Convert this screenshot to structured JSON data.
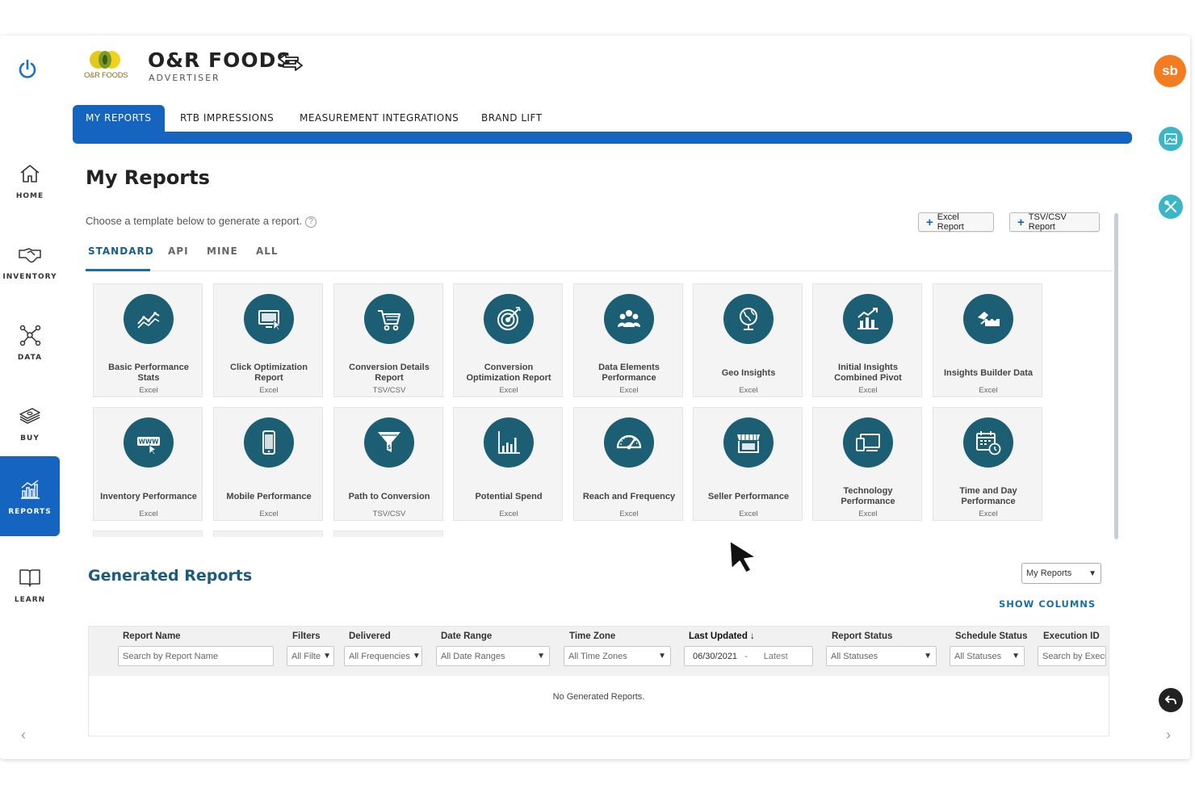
{
  "nav": {
    "items": [
      {
        "label": "HOME",
        "icon": "home-icon"
      },
      {
        "label": "INVENTORY",
        "icon": "handshake-icon"
      },
      {
        "label": "DATA",
        "icon": "network-icon"
      },
      {
        "label": "BUY",
        "icon": "money-icon"
      },
      {
        "label": "REPORTS",
        "icon": "bar-chart-icon"
      },
      {
        "label": "LEARN",
        "icon": "book-icon"
      }
    ],
    "active": "REPORTS",
    "accent": "#1565c0"
  },
  "header": {
    "logo_text": "O&R FOODS",
    "brand_name": "O&R FOODS",
    "brand_sub": "ADVERTISER"
  },
  "top_tabs": [
    "MY REPORTS",
    "RTB IMPRESSIONS",
    "MEASUREMENT INTEGRATIONS",
    "BRAND LIFT"
  ],
  "page": {
    "title": "My Reports",
    "subtext": "Choose a template below to generate a report.",
    "add_excel": "Excel Report",
    "add_tsv": "TSV/CSV Report"
  },
  "sub_tabs": [
    "STANDARD",
    "API",
    "MINE",
    "ALL"
  ],
  "templates": [
    {
      "name": "Basic Performance Stats",
      "type": "Excel",
      "icon": "trend-line-icon"
    },
    {
      "name": "Click Optimization Report",
      "type": "Excel",
      "icon": "monitor-click-icon"
    },
    {
      "name": "Conversion Details Report",
      "type": "TSV/CSV",
      "icon": "shopping-cart-icon"
    },
    {
      "name": "Conversion Optimization Report",
      "type": "Excel",
      "icon": "target-icon"
    },
    {
      "name": "Data Elements Performance",
      "type": "Excel",
      "icon": "people-group-icon"
    },
    {
      "name": "Geo Insights",
      "type": "Excel",
      "icon": "globe-icon"
    },
    {
      "name": "Initial Insights Combined Pivot",
      "type": "Excel",
      "icon": "growth-chart-icon"
    },
    {
      "name": "Insights Builder Data",
      "type": "Excel",
      "icon": "puzzle-icon"
    },
    {
      "name": "Inventory Performance",
      "type": "Excel",
      "icon": "www-click-icon"
    },
    {
      "name": "Mobile Performance",
      "type": "Excel",
      "icon": "mobile-phone-icon"
    },
    {
      "name": "Path to Conversion",
      "type": "TSV/CSV",
      "icon": "funnel-icon"
    },
    {
      "name": "Potential Spend",
      "type": "Excel",
      "icon": "bar-graph-icon"
    },
    {
      "name": "Reach and Frequency",
      "type": "Excel",
      "icon": "speedometer-icon"
    },
    {
      "name": "Seller Performance",
      "type": "Excel",
      "icon": "storefront-icon"
    },
    {
      "name": "Technology Performance",
      "type": "Excel",
      "icon": "devices-icon"
    },
    {
      "name": "Time and Day Performance",
      "type": "Excel",
      "icon": "calendar-clock-icon"
    }
  ],
  "generated": {
    "title": "Generated Reports",
    "scope_select": "My Reports",
    "show_columns": "SHOW COLUMNS",
    "columns": [
      {
        "header": "Report Name",
        "filter": "Search by Report Name"
      },
      {
        "header": "Filters",
        "filter": "All Filters"
      },
      {
        "header": "Delivered",
        "filter": "All Frequencies"
      },
      {
        "header": "Date Range",
        "filter": "All Date Ranges"
      },
      {
        "header": "Time Zone",
        "filter": "All Time Zones"
      },
      {
        "header": "Last Updated ↓",
        "filter_from": "06/30/2021",
        "filter_sep": "-",
        "filter_to": "Latest"
      },
      {
        "header": "Report Status",
        "filter": "All Statuses"
      },
      {
        "header": "Schedule Status",
        "filter": "All Statuses"
      },
      {
        "header": "Execution ID",
        "filter": "Search by Execution ID"
      }
    ],
    "empty_message": "No Generated Reports."
  },
  "rail": {
    "avatar": "sb",
    "avatar_color": "#f47b20",
    "icon_color": "#3bb6c8"
  },
  "colors": {
    "tile_icon_bg": "#1c5f74",
    "accent": "#1565c0",
    "section_title": "#1a5c7a"
  }
}
